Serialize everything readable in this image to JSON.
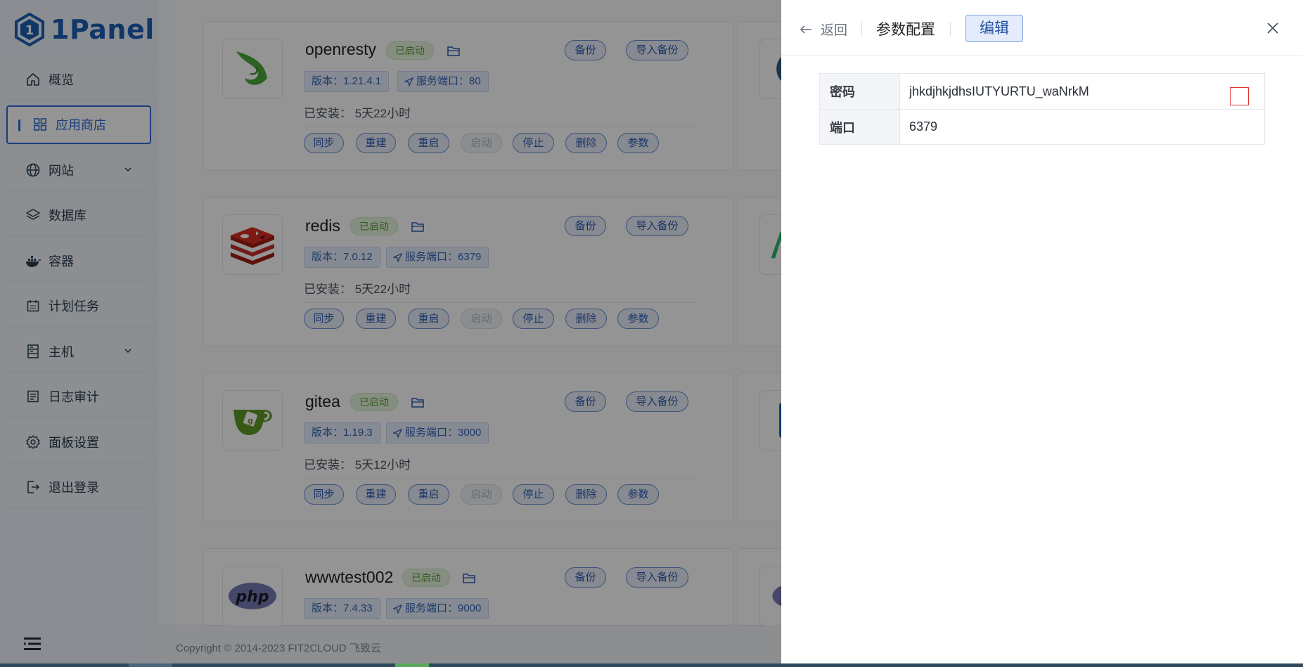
{
  "brand": {
    "name": "1Panel",
    "accent": "#2f6bd6"
  },
  "sidebar": {
    "items": [
      {
        "label": "概览",
        "icon": "home-icon"
      },
      {
        "label": "应用商店",
        "icon": "grid-icon",
        "active": true
      },
      {
        "label": "网站",
        "icon": "globe-icon",
        "has_children": true
      },
      {
        "label": "数据库",
        "icon": "layers-icon"
      },
      {
        "label": "容器",
        "icon": "docker-icon"
      },
      {
        "label": "计划任务",
        "icon": "calendar-icon"
      },
      {
        "label": "主机",
        "icon": "server-icon",
        "has_children": true
      },
      {
        "label": "日志审计",
        "icon": "log-icon"
      },
      {
        "label": "面板设置",
        "icon": "gear-icon"
      },
      {
        "label": "退出登录",
        "icon": "logout-icon"
      }
    ]
  },
  "apps": [
    {
      "name": "openresty",
      "status": "已启动",
      "version": "版本：1.21.4.1",
      "port": "服务端口：80",
      "installed": "已安装：  5天22小时"
    },
    {
      "name": "redis",
      "status": "已启动",
      "version": "版本：7.0.12",
      "port": "服务端口：6379",
      "installed": "已安装：  5天22小时"
    },
    {
      "name": "gitea",
      "status": "已启动",
      "version": "版本：1.19.3",
      "port": "服务端口：3000",
      "installed": "已安装：  5天12小时"
    },
    {
      "name": "wwwtest002",
      "status": "已启动",
      "version": "版本：7.4.33",
      "port": "服务端口：9000",
      "installed": ""
    }
  ],
  "card_buttons": {
    "backup": "备份",
    "import_backup": "导入备份"
  },
  "actions": {
    "sync": "同步",
    "rebuild": "重建",
    "restart": "重启",
    "start": "启动",
    "stop": "停止",
    "delete": "删除",
    "params": "参数"
  },
  "footer": {
    "copyright": "Copyright © 2014-2023 FIT2CLOUD 飞致云"
  },
  "drawer": {
    "back_label": "返回",
    "title": "参数配置",
    "edit_label": "编辑",
    "params": [
      {
        "key": "密码",
        "value": "jhkdjhkjdhsIUTYURTU_waNrkM"
      },
      {
        "key": "端口",
        "value": "6379"
      }
    ]
  }
}
